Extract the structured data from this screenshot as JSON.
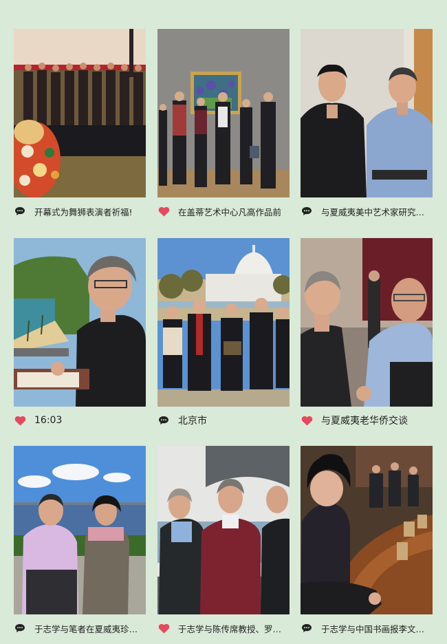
{
  "colors": {
    "background": "#d9ead8",
    "heart": "#e5495e",
    "comment": "#222222"
  },
  "tiles": [
    {
      "caption": "开幕式为舞狮表演者祈福!",
      "icon": "comment-icon"
    },
    {
      "caption": "在盖蒂艺术中心凡高作品前",
      "icon": "heart-icon"
    },
    {
      "caption": "与夏威夷美中艺术家研究…",
      "icon": "comment-icon"
    },
    {
      "caption": "16:03",
      "icon": "heart-icon"
    },
    {
      "caption": "北京市",
      "icon": "comment-icon"
    },
    {
      "caption": "与夏威夷老华侨交谈",
      "icon": "heart-icon"
    },
    {
      "caption": "于志学与笔者在夏威夷珍…",
      "icon": "comment-icon"
    },
    {
      "caption": "于志学与陈传席教授、罗…",
      "icon": "heart-icon"
    },
    {
      "caption": "于志学与中国书画报李文…",
      "icon": "comment-icon"
    }
  ]
}
